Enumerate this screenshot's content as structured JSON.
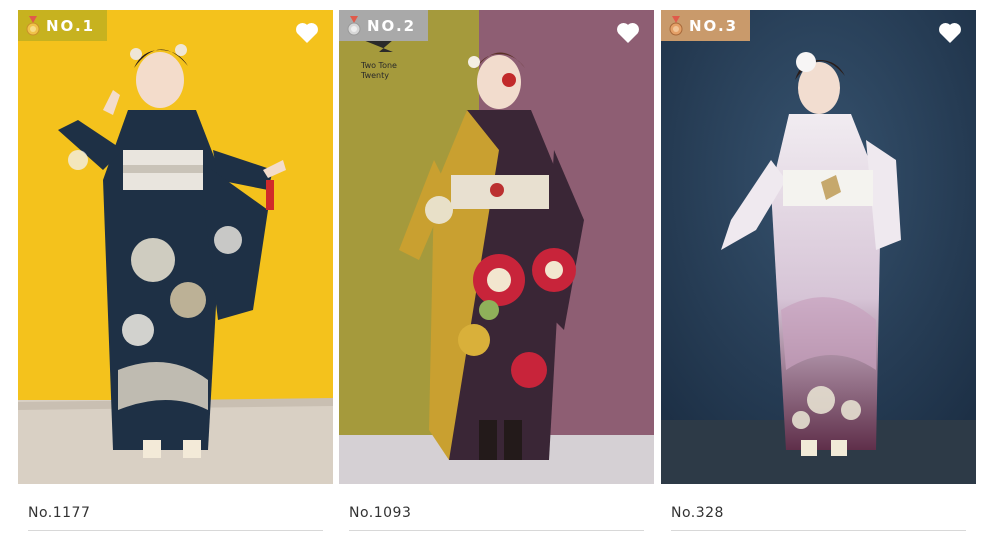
{
  "products": [
    {
      "rank_label": "NO.1",
      "rank_color": "#c7b21f",
      "medal": "gold-medal-icon",
      "product_label": "No.1177",
      "backdrop": [
        "#f4c21c",
        "#f1bd1a"
      ],
      "floor": "#d9d0c4",
      "kimono": "#1e3045",
      "accent": "#f2efe6"
    },
    {
      "rank_label": "NO.2",
      "rank_color": "#a9a9a9",
      "medal": "silver-medal-icon",
      "product_label": "No.1093",
      "brand_line1": "Two Tone",
      "brand_line2": "Twenty",
      "backdrop": [
        "#a59a3c",
        "#8e5e73"
      ],
      "floor": "#d5d0d4",
      "kimono": "#3a2636",
      "accent": "#c9a030"
    },
    {
      "rank_label": "NO.3",
      "rank_color": "#c99a6b",
      "medal": "bronze-medal-icon",
      "product_label": "No.328",
      "backdrop": [
        "#2e4a66",
        "#22374f"
      ],
      "floor": "#2d3a47",
      "kimono": "#efe9ef",
      "accent": "#6d3a55"
    }
  ],
  "favorite_icon": "heart-outline-icon"
}
